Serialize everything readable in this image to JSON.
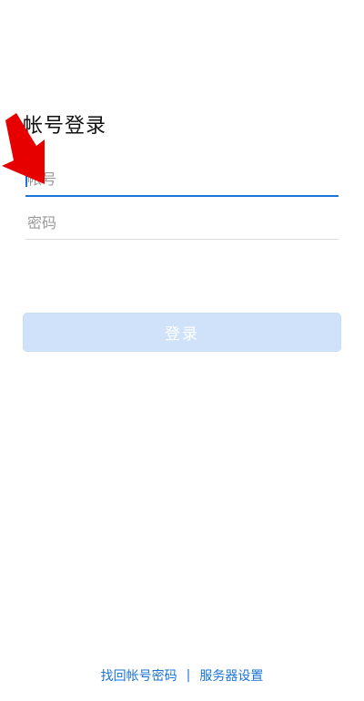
{
  "page": {
    "title": "帐号登录"
  },
  "form": {
    "username_placeholder": "帐号",
    "password_placeholder": "密码",
    "login_label": "登录"
  },
  "footer": {
    "recover_link": "找回帐号密码",
    "separator": "|",
    "server_link": "服务器设置"
  },
  "colors": {
    "accent": "#1a73d9",
    "button_disabled": "#cfe2fa",
    "annotation_arrow": "#e60000"
  },
  "icons": {
    "annotation": "red-arrow-icon"
  }
}
